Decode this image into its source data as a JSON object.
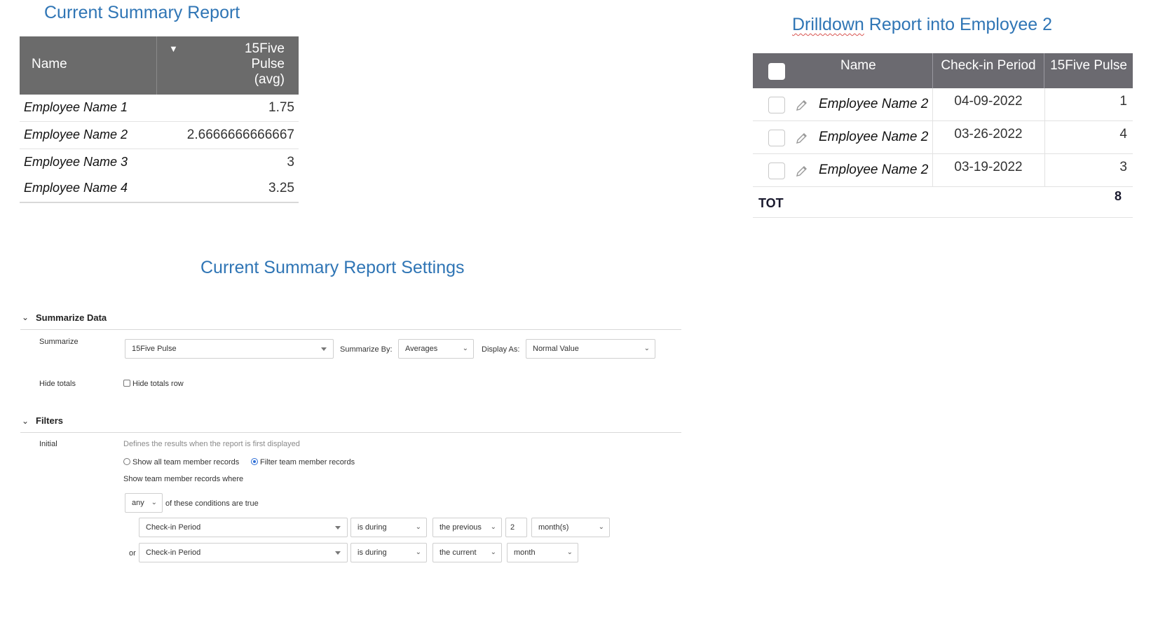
{
  "titles": {
    "summary": "Current Summary Report",
    "drilldown_word1": "Drilldown",
    "drilldown_rest": " Report into Employee 2",
    "settings": "Current Summary Report Settings"
  },
  "summary_table": {
    "col_name": "Name",
    "col_value_line1": "15Five",
    "col_value_line2": "Pulse",
    "col_value_line3": "(avg)",
    "rows": [
      {
        "name": "Employee Name 1",
        "value": "1.75"
      },
      {
        "name": "Employee Name 2",
        "value": "2.6666666666667"
      },
      {
        "name": "Employee Name 3",
        "value": "3"
      },
      {
        "name": "Employee Name 4",
        "value": "3.25"
      }
    ]
  },
  "drilldown_table": {
    "col_name": "Name",
    "col_period": "Check-in Period",
    "col_pulse": "15Five Pulse",
    "rows": [
      {
        "name": "Employee Name 2",
        "period": "04-09-2022",
        "pulse": "1"
      },
      {
        "name": "Employee Name 2",
        "period": "03-26-2022",
        "pulse": "4"
      },
      {
        "name": "Employee Name 2",
        "period": "03-19-2022",
        "pulse": "3"
      }
    ],
    "total_label": "TOT",
    "total_value": "8"
  },
  "settings": {
    "summarize_section": "Summarize Data",
    "summarize_label": "Summarize",
    "summarize_field": "15Five Pulse",
    "summarize_by_label": "Summarize By:",
    "summarize_by_value": "Averages",
    "display_as_label": "Display As:",
    "display_as_value": "Normal Value",
    "hide_totals_label": "Hide totals",
    "hide_totals_checkbox": "Hide totals row",
    "filters_section": "Filters",
    "initial_label": "Initial",
    "initial_desc": "Defines the results when the report is first displayed",
    "radio_all": "Show all team member records",
    "radio_filter": "Filter team member records",
    "show_where": "Show team member records where",
    "match_value": "any",
    "match_suffix": "of these conditions are true",
    "conditions": [
      {
        "prefix": "",
        "field": "Check-in Period",
        "operator": "is during",
        "range": "the previous",
        "number": "2",
        "unit": "month(s)"
      },
      {
        "prefix": "or",
        "field": "Check-in Period",
        "operator": "is during",
        "range": "the current",
        "unit": "month"
      }
    ]
  }
}
